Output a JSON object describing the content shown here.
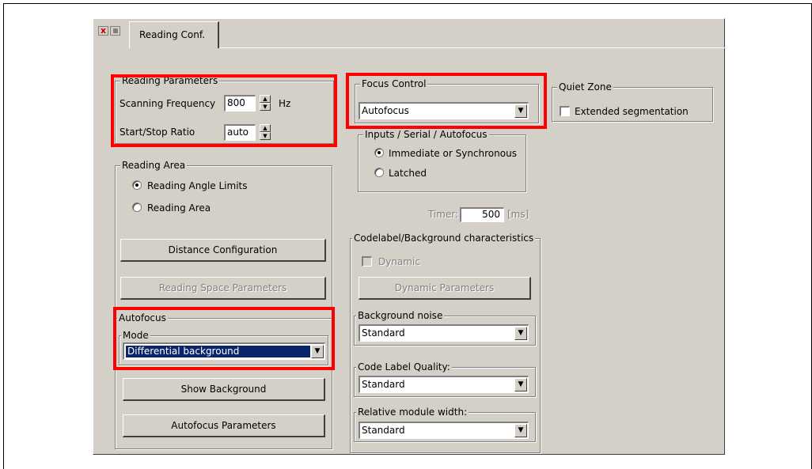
{
  "tab": {
    "label": "Reading Conf."
  },
  "reading_parameters": {
    "title": "Reading Parameters",
    "scanning_frequency_label": "Scanning Frequency",
    "scanning_frequency_value": "800",
    "scanning_frequency_unit": "Hz",
    "start_stop_label": "Start/Stop Ratio",
    "start_stop_value": "auto"
  },
  "reading_area": {
    "title": "Reading Area",
    "option_angle_limits": "Reading Angle Limits",
    "option_reading_area": "Reading Area",
    "selected": "Reading Angle Limits",
    "distance_button": "Distance Configuration",
    "space_params_button": "Reading Space Parameters"
  },
  "autofocus": {
    "title": "Autofocus",
    "mode_title": "Mode",
    "mode_value": "Differential background",
    "show_background_button": "Show Background",
    "parameters_button": "Autofocus Parameters"
  },
  "focus_control": {
    "title": "Focus Control",
    "value": "Autofocus"
  },
  "inputs": {
    "title": "Inputs / Serial / Autofocus",
    "option_immediate": "Immediate or Synchronous",
    "option_latched": "Latched",
    "selected": "Immediate or Synchronous",
    "timer_label": "Timer:",
    "timer_value": "500",
    "timer_unit": "[ms]"
  },
  "codelabel": {
    "title": "Codelabel/Background characteristics",
    "dynamic_label": "Dynamic",
    "dynamic_checked": false,
    "dynamic_params_button": "Dynamic Parameters",
    "background_noise_title": "Background noise",
    "background_noise_value": "Standard",
    "code_label_quality_title": "Code Label Quality:",
    "code_label_quality_value": "Standard",
    "relative_width_title": "Relative module width:",
    "relative_width_value": "Standard"
  },
  "quiet_zone": {
    "title": "Quiet Zone",
    "extended_segmentation_label": "Extended segmentation",
    "extended_segmentation_checked": false
  },
  "colors": {
    "highlight": "#ff0000",
    "panel": "#d4d0c8",
    "selection": "#0a246a"
  }
}
